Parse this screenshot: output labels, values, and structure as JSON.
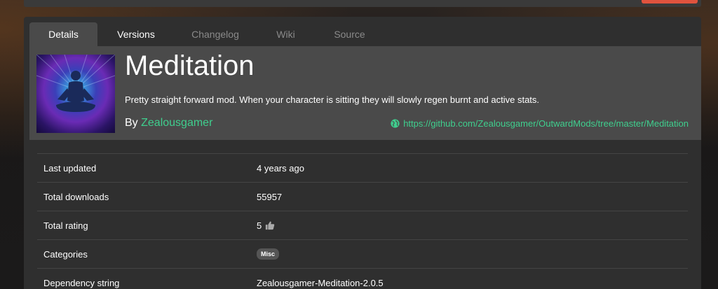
{
  "tabs": [
    {
      "label": "Details",
      "active": true
    },
    {
      "label": "Versions"
    },
    {
      "label": "Changelog"
    },
    {
      "label": "Wiki"
    },
    {
      "label": "Source"
    }
  ],
  "mod": {
    "title": "Meditation",
    "description": "Pretty straight forward mod. When your character is sitting they will slowly regen burnt and active stats.",
    "by_label": "By",
    "author": "Zealousgamer",
    "repo_url": "https://github.com/Zealousgamer/OutwardMods/tree/master/Meditation"
  },
  "details": [
    {
      "label": "Last updated",
      "value": "4 years ago"
    },
    {
      "label": "Total downloads",
      "value": "55957"
    },
    {
      "label": "Total rating",
      "value": "5",
      "icon": "thumbs-up-icon"
    },
    {
      "label": "Categories",
      "badge": "Misc"
    },
    {
      "label": "Dependency string",
      "value": "Zealousgamer-Meditation-2.0.5"
    }
  ],
  "colors": {
    "accent": "#3fcf8e",
    "alert": "#e0533e",
    "panel": "#2f2f2f",
    "header": "#4a4a4a"
  }
}
